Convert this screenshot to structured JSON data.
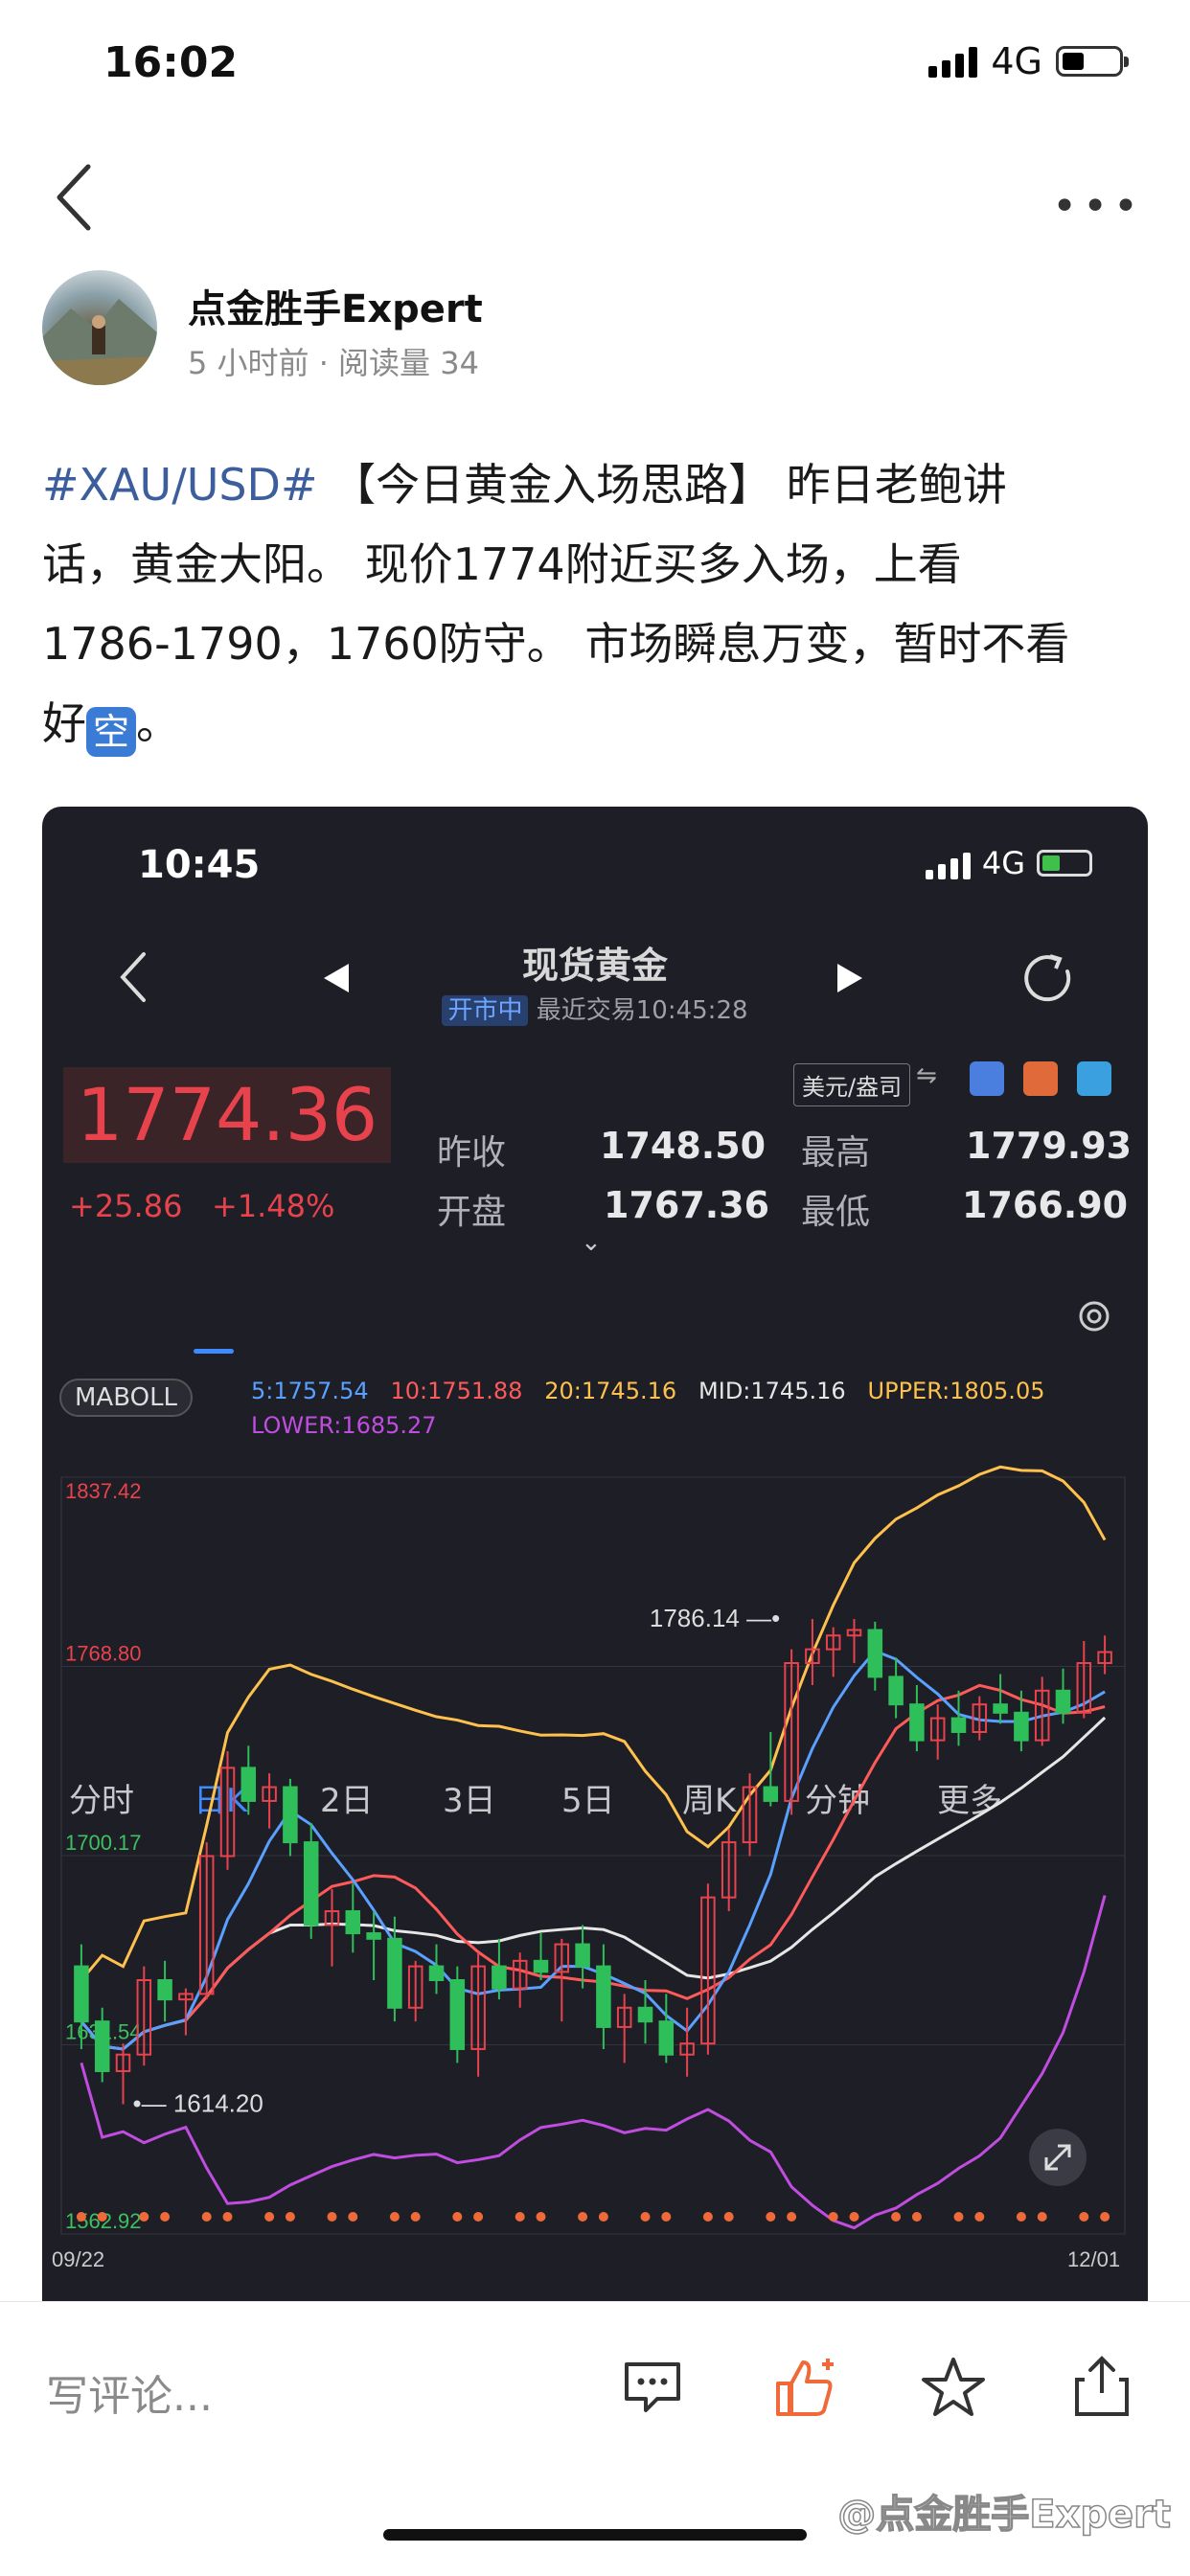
{
  "status": {
    "time": "16:02",
    "network": "4G"
  },
  "header": {
    "back_icon": "chevron-left-icon",
    "more_icon": "more-dots-icon"
  },
  "author": {
    "name": "点金胜手Expert",
    "meta": "5 小时前 · 阅读量 34"
  },
  "post": {
    "tag": "#XAU/USD#",
    "line1_rest": " 【今日黄金入场思路】 昨日老鲍讲",
    "line2": "话，黄金大阳。 现价1774附近买多入场，上看",
    "line3": "1786-1790，1760防守。 市场瞬息万变，暂时不看",
    "line4_pre": "好",
    "emoji": "空",
    "line4_post": "。"
  },
  "screenshot": {
    "status_time": "10:45",
    "network": "4G",
    "title": "现货黄金",
    "open_badge": "开市中",
    "last_trade": "最近交易10:45:28",
    "price": "1774.36",
    "change_abs": "+25.86",
    "change_pct": "+1.48%",
    "unit": "美元/盎司",
    "quote": {
      "prev_close_label": "昨收",
      "prev_close": "1748.50",
      "high_label": "最高",
      "high": "1779.93",
      "open_label": "开盘",
      "open": "1767.36",
      "low_label": "最低",
      "low": "1766.90"
    },
    "tabs": [
      "分时",
      "日K",
      "2日",
      "3日",
      "5日",
      "周K",
      "分钟",
      "更多"
    ],
    "active_tab": "日K",
    "indicator": "MABOLL",
    "legend": {
      "ma5": "5:1757.54",
      "ma10": "10:1751.88",
      "ma20": "20:1745.16",
      "mid": "MID:1745.16",
      "upper": "UPPER:1805.05",
      "lower": "LOWER:1685.27"
    },
    "colors": {
      "up": "#e8434d",
      "down": "#2fbf5a",
      "ma5": "#5aa0ff",
      "ma10": "#ff5a5a",
      "ma20": "#ffc14d",
      "mid": "#e6e6e6",
      "lower": "#c04de0"
    }
  },
  "chart_data": {
    "type": "candlestick",
    "title": "",
    "y_axis_labels": [
      "1837.42",
      "1768.80",
      "1700.17",
      "1631.54",
      "1562.92"
    ],
    "ylim": [
      1562.92,
      1837.42
    ],
    "x_start": "09/22",
    "x_end": "12/01",
    "annotations": [
      {
        "label": "1786.14"
      },
      {
        "label": "1614.20"
      }
    ],
    "candles": [
      [
        1660,
        1668,
        1630,
        1640
      ],
      [
        1640,
        1645,
        1618,
        1622
      ],
      [
        1622,
        1632,
        1610,
        1628
      ],
      [
        1628,
        1660,
        1624,
        1655
      ],
      [
        1655,
        1662,
        1640,
        1648
      ],
      [
        1648,
        1652,
        1635,
        1650
      ],
      [
        1650,
        1705,
        1648,
        1700
      ],
      [
        1700,
        1738,
        1695,
        1732
      ],
      [
        1732,
        1740,
        1715,
        1720
      ],
      [
        1720,
        1730,
        1710,
        1725
      ],
      [
        1725,
        1728,
        1700,
        1705
      ],
      [
        1705,
        1712,
        1670,
        1675
      ],
      [
        1675,
        1688,
        1660,
        1680
      ],
      [
        1680,
        1690,
        1665,
        1672
      ],
      [
        1672,
        1680,
        1655,
        1670
      ],
      [
        1670,
        1678,
        1640,
        1645
      ],
      [
        1645,
        1662,
        1640,
        1660
      ],
      [
        1660,
        1668,
        1650,
        1655
      ],
      [
        1655,
        1660,
        1625,
        1630
      ],
      [
        1630,
        1665,
        1620,
        1660
      ],
      [
        1660,
        1670,
        1648,
        1652
      ],
      [
        1652,
        1665,
        1645,
        1662
      ],
      [
        1662,
        1672,
        1655,
        1658
      ],
      [
        1658,
        1670,
        1640,
        1668
      ],
      [
        1668,
        1675,
        1652,
        1660
      ],
      [
        1660,
        1668,
        1630,
        1638
      ],
      [
        1638,
        1650,
        1625,
        1645
      ],
      [
        1645,
        1655,
        1632,
        1640
      ],
      [
        1640,
        1650,
        1625,
        1628
      ],
      [
        1628,
        1645,
        1620,
        1632
      ],
      [
        1632,
        1690,
        1628,
        1685
      ],
      [
        1685,
        1710,
        1680,
        1705
      ],
      [
        1705,
        1730,
        1700,
        1725
      ],
      [
        1725,
        1745,
        1718,
        1720
      ],
      [
        1720,
        1775,
        1715,
        1770
      ],
      [
        1770,
        1786,
        1762,
        1775
      ],
      [
        1775,
        1783,
        1765,
        1780
      ],
      [
        1780,
        1786,
        1770,
        1782
      ],
      [
        1782,
        1785,
        1760,
        1765
      ],
      [
        1765,
        1772,
        1750,
        1755
      ],
      [
        1755,
        1762,
        1738,
        1742
      ],
      [
        1742,
        1755,
        1735,
        1750
      ],
      [
        1750,
        1760,
        1740,
        1745
      ],
      [
        1745,
        1758,
        1742,
        1755
      ],
      [
        1755,
        1766,
        1748,
        1752
      ],
      [
        1752,
        1760,
        1738,
        1742
      ],
      [
        1742,
        1765,
        1740,
        1760
      ],
      [
        1760,
        1768,
        1748,
        1752
      ],
      [
        1752,
        1778,
        1750,
        1770
      ],
      [
        1770,
        1780,
        1766,
        1774
      ]
    ]
  },
  "bottom": {
    "comment_placeholder": "写评论...",
    "comment_icon": "comment-icon",
    "like_icon": "thumbs-up-icon",
    "star_icon": "star-icon",
    "share_icon": "share-icon",
    "watermark": "@点金胜手Expert"
  }
}
